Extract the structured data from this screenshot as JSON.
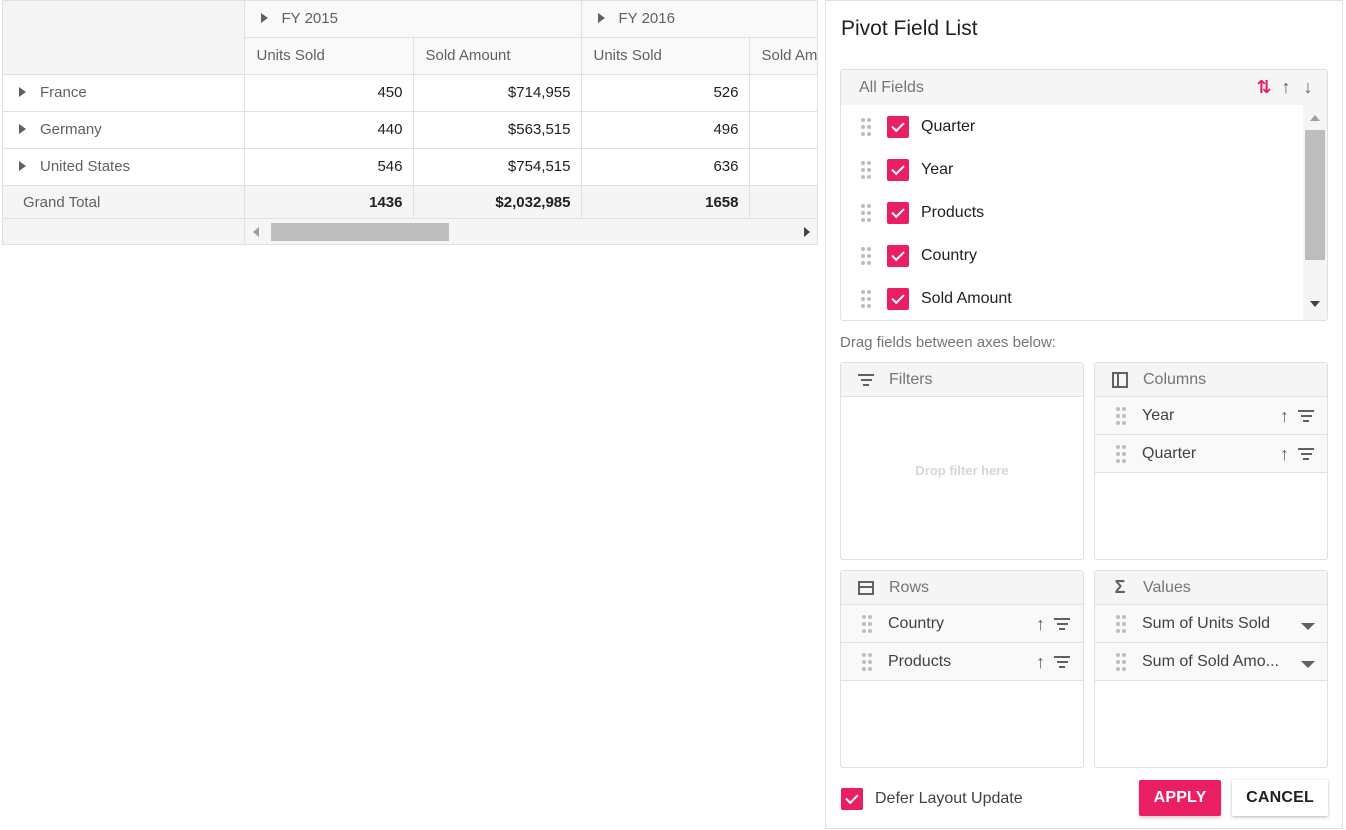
{
  "grid": {
    "column_groups": [
      {
        "label": "FY 2015"
      },
      {
        "label": "FY 2016"
      }
    ],
    "measures": [
      "Units Sold",
      "Sold Amount",
      "Units Sold",
      "Sold Amount"
    ],
    "rows": [
      {
        "label": "France",
        "values": [
          "450",
          "$714,955",
          "526",
          ""
        ]
      },
      {
        "label": "Germany",
        "values": [
          "440",
          "$563,515",
          "496",
          ""
        ]
      },
      {
        "label": "United States",
        "values": [
          "546",
          "$754,515",
          "636",
          ""
        ]
      }
    ],
    "grand_total": {
      "label": "Grand Total",
      "values": [
        "1436",
        "$2,032,985",
        "1658",
        ""
      ]
    }
  },
  "field_list": {
    "title": "Pivot Field List",
    "all_fields_label": "All Fields",
    "sort_icons": [
      "sort-none-icon",
      "sort-ascending-icon",
      "sort-descending-icon"
    ],
    "fields": [
      {
        "label": "Quarter",
        "checked": true
      },
      {
        "label": "Year",
        "checked": true
      },
      {
        "label": "Products",
        "checked": true
      },
      {
        "label": "Country",
        "checked": true
      },
      {
        "label": "Sold Amount",
        "checked": true
      }
    ],
    "drag_hint": "Drag fields between axes below:",
    "axes": {
      "filters": {
        "label": "Filters",
        "placeholder": "Drop filter here",
        "items": []
      },
      "columns": {
        "label": "Columns",
        "items": [
          "Year",
          "Quarter"
        ]
      },
      "rows": {
        "label": "Rows",
        "items": [
          "Country",
          "Products"
        ]
      },
      "values": {
        "label": "Values",
        "items": [
          "Sum of Units Sold",
          "Sum of Sold Amo..."
        ]
      }
    },
    "defer_layout_label": "Defer Layout Update",
    "defer_layout_checked": true,
    "apply_label": "APPLY",
    "cancel_label": "CANCEL"
  },
  "colors": {
    "accent": "#e91e63",
    "header_bg": "#f5f5f5",
    "border": "#e0e0e0"
  }
}
